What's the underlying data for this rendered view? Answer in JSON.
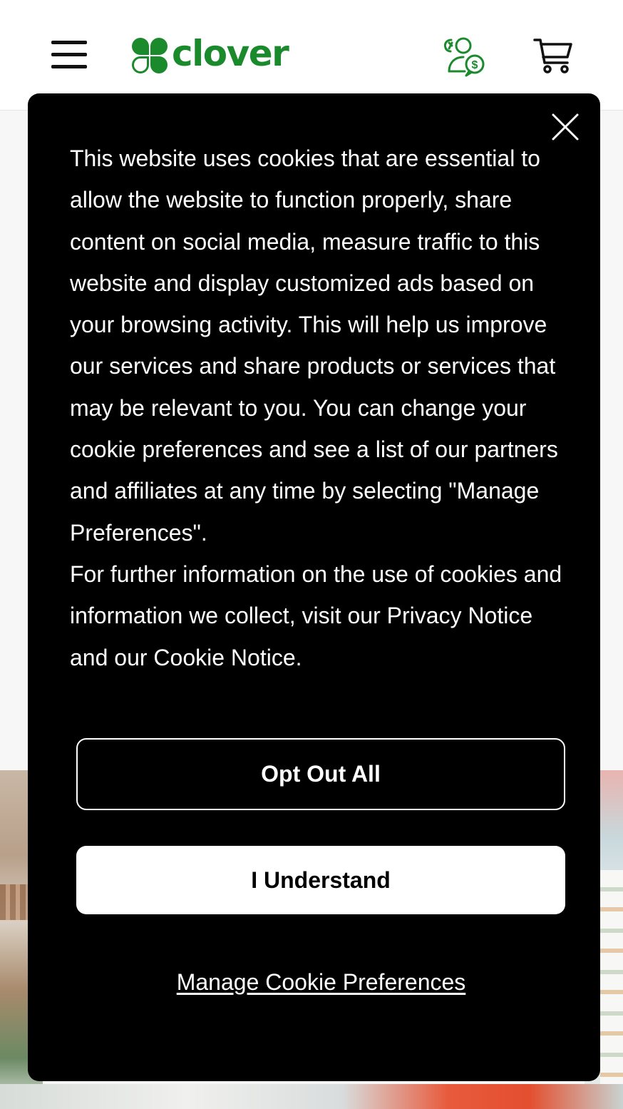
{
  "brand": {
    "name": "clover",
    "color": "#1b8a2d"
  },
  "header": {
    "menu_icon": "hamburger-menu-icon",
    "sales_icon": "sales-contact-icon",
    "cart_icon": "shopping-cart-icon"
  },
  "cookie_banner": {
    "paragraphs": [
      "This website uses cookies that are essential to allow the website to function properly, share content on social media, measure traffic to this website and display customized ads based on your browsing activity. This will help us improve our services and share products or services that may be relevant to you. You can change your cookie preferences and see a list of our partners and affiliates at any time by selecting \"Manage Preferences\".",
      "For further information on the use of cookies and information we collect, visit our Privacy Notice and our Cookie Notice."
    ],
    "close_icon": "close-icon",
    "opt_out_label": "Opt Out All",
    "understand_label": "I Understand",
    "manage_label": "Manage Cookie Preferences",
    "background_color": "#000000",
    "text_color": "#ffffff"
  }
}
